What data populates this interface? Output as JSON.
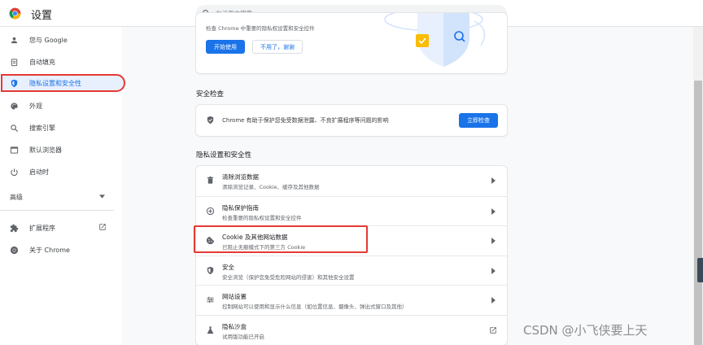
{
  "header": {
    "title": "设置",
    "search_placeholder": "在设置中搜索"
  },
  "sidebar": {
    "items": [
      {
        "label": "您与 Google",
        "icon": "person-icon"
      },
      {
        "label": "自动填充",
        "icon": "clipboard-icon"
      },
      {
        "label": "隐私设置和安全性",
        "icon": "shield-icon",
        "active": true
      },
      {
        "label": "外观",
        "icon": "palette-icon"
      },
      {
        "label": "搜索引擎",
        "icon": "search-icon"
      },
      {
        "label": "默认浏览器",
        "icon": "browser-icon"
      },
      {
        "label": "启动时",
        "icon": "power-icon"
      }
    ],
    "advanced_label": "高级",
    "extensions_label": "扩展程序",
    "about_label": "关于 Chrome"
  },
  "promo": {
    "text": "检查 Chrome 中重要的隐私权设置和安全控件",
    "start_button": "开始使用",
    "dismiss_button": "不用了，谢谢"
  },
  "safety_check": {
    "heading": "安全检查",
    "text": "Chrome 有助于保护您免受数据泄露、不良扩展程序等问题的影响",
    "button": "立即检查"
  },
  "privacy": {
    "heading": "隐私设置和安全性",
    "rows": [
      {
        "title": "清除浏览数据",
        "subtitle": "清除浏览记录、Cookie、缓存及其他数据",
        "icon": "trash-icon"
      },
      {
        "title": "隐私保护指南",
        "subtitle": "检查重要的隐私权设置和安全控件",
        "icon": "add-circle-icon"
      },
      {
        "title": "Cookie 及其他网站数据",
        "subtitle": "已阻止无痕模式下的第三方 Cookie",
        "icon": "cookie-icon"
      },
      {
        "title": "安全",
        "subtitle": "安全浏览（保护您免受危险网站的侵害）和其他安全设置",
        "icon": "shield-icon"
      },
      {
        "title": "网站设置",
        "subtitle": "控制网站可以使用和显示什么信息（如位置信息、摄像头、弹出式窗口及其他）",
        "icon": "sliders-icon"
      },
      {
        "title": "隐私沙盒",
        "subtitle": "试用版功能已开启",
        "icon": "flask-icon"
      }
    ]
  },
  "watermark": "CSDN @小飞侠要上天",
  "colors": {
    "accent": "#1a73e8",
    "highlight": "#e53935",
    "active_bg": "#e8f0fe"
  }
}
